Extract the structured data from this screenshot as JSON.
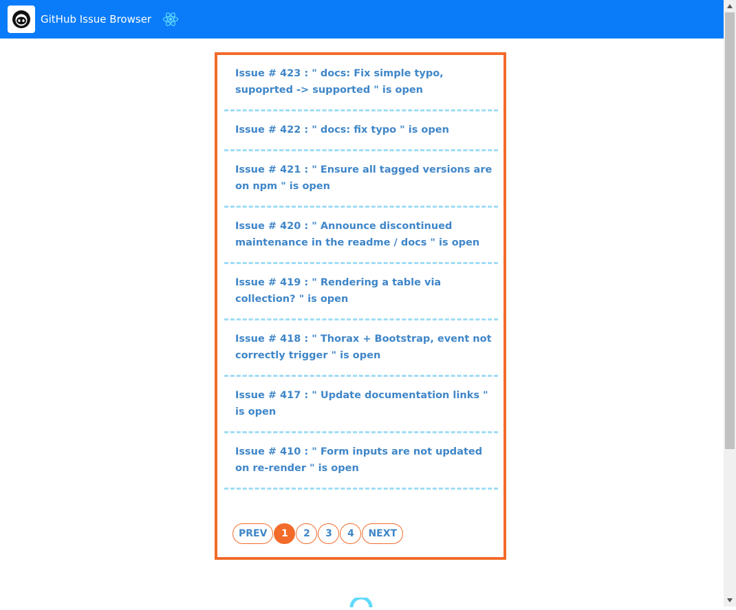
{
  "header": {
    "title": "GitHub Issue Browser",
    "logo_icon": "github-octocat-icon",
    "framework_icon": "react-atom-icon",
    "bar_color": "#0a7cf9"
  },
  "issues": [
    {
      "label": "Issue # 423 : \" docs: Fix simple typo, supoprted -> supported \" is open"
    },
    {
      "label": "Issue # 422 : \" docs: fix typo \" is open"
    },
    {
      "label": "Issue # 421 : \" Ensure all tagged versions are on npm \" is open"
    },
    {
      "label": "Issue # 420 : \" Announce discontinued maintenance in the readme / docs \" is open"
    },
    {
      "label": "Issue # 419 : \" Rendering a table via collection? \" is open"
    },
    {
      "label": "Issue # 418 : \" Thorax + Bootstrap, event not correctly trigger \" is open"
    },
    {
      "label": "Issue # 417 : \" Update documentation links \" is open"
    },
    {
      "label": "Issue # 410 : \" Form inputs are not updated on re-render \" is open"
    }
  ],
  "pagination": {
    "prev_label": "PREV",
    "pages": [
      "1",
      "2",
      "3",
      "4"
    ],
    "active_page": "1",
    "next_label": "NEXT"
  },
  "colors": {
    "accent": "#f26b2a",
    "link": "#3f86c8",
    "divider": "#9fdcf5"
  }
}
